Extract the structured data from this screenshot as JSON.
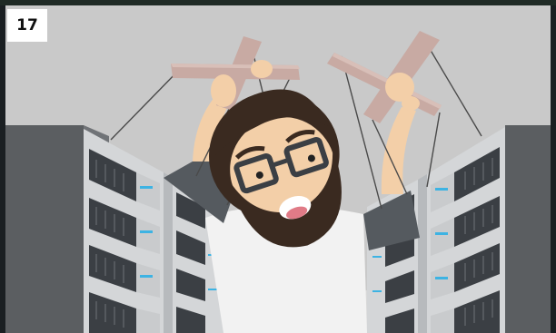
{
  "slide": {
    "number": "17"
  },
  "illustration": {
    "subject": "puppeteer-hands-with-controllers",
    "character": "bearded-man-with-glasses",
    "background": "server-racks"
  },
  "colors": {
    "background_wall": "#c9c9c9",
    "rack_dark": "#5b5e61",
    "rack_light": "#d4d6d8",
    "server_unit": "#3b3f44",
    "led_blue": "#3db3e3",
    "hair": "#3a2a20",
    "skin": "#f3cfa8",
    "controller": "#c8aaa3",
    "shirt": "#f2f2f2"
  }
}
